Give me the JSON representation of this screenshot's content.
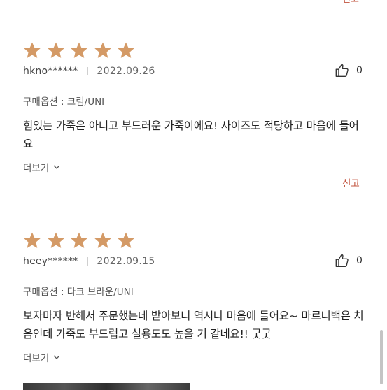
{
  "prev_review": {
    "report_label": "신고"
  },
  "reviews": [
    {
      "rating": 5,
      "user": "hkno******",
      "date": "2022.09.26",
      "likes": "0",
      "option": "구매옵션 : 크림/UNI",
      "text": "힘있는 가죽은 아니고 부드러운 가죽이에요! 사이즈도 적당하고 마음에 들어요",
      "more_label": "더보기",
      "report_label": "신고"
    },
    {
      "rating": 5,
      "user": "heey******",
      "date": "2022.09.15",
      "likes": "0",
      "option": "구매옵션 : 다크 브라운/UNI",
      "text": "보자마자 반해서 주문했는데 받아보니 역시나 마음에 들어요~ 마르니백은 처음인데 가죽도 부드럽고 실용도도 높을 거 같네요!! 굿굿",
      "more_label": "더보기"
    }
  ],
  "colors": {
    "star": "#d49a66",
    "report": "#c2543f",
    "divider": "#e2e2e2"
  },
  "icons": {
    "star": "star-icon",
    "like": "thumbs-up-icon",
    "more": "chevron-down-icon"
  }
}
